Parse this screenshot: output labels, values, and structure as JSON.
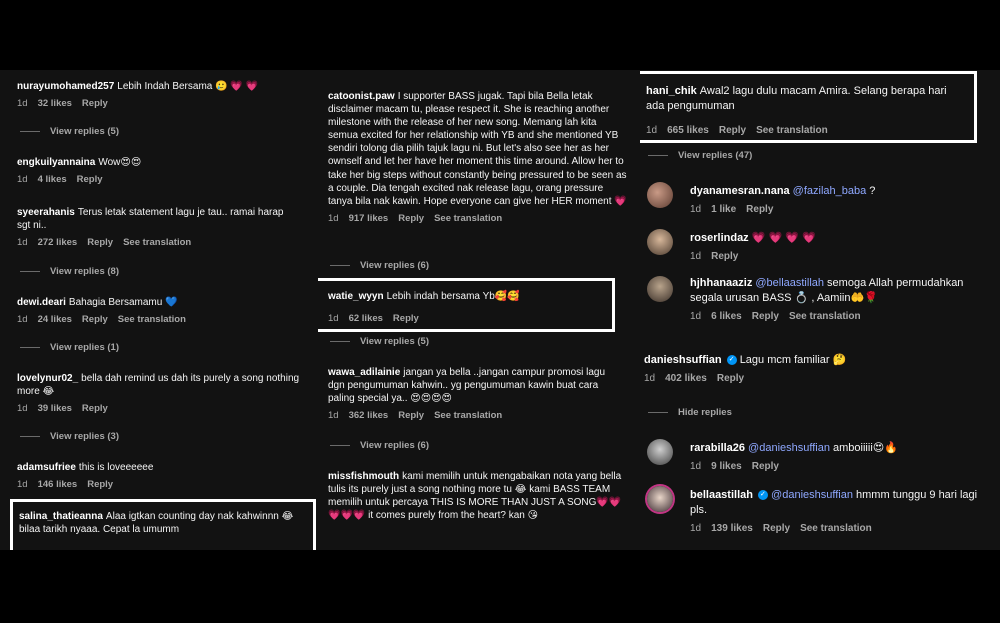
{
  "colors": {
    "background": "#000000",
    "panel": "#121212",
    "meta_text": "#a8a8a8",
    "heart": "#ff3040",
    "mention": "#8fa8ff",
    "highlight_box": "#ffffff"
  },
  "ui": {
    "reply": "Reply",
    "see_translation": "See translation",
    "hide_replies": "Hide replies"
  },
  "col1": {
    "c1": {
      "user": "nurayumohamed257",
      "text": "Lebih Indah Bersama 🥲 💗 💗",
      "time": "1d",
      "likes": "32 likes",
      "view_replies": "View replies (5)"
    },
    "c2": {
      "user": "engkuilyannaina",
      "text": "Wow😍😍",
      "time": "1d",
      "likes": "4 likes"
    },
    "c3": {
      "user": "syeerahanis",
      "text": "Terus letak statement lagu je tau.. ramai harap sgt ni..",
      "time": "1d",
      "likes": "272 likes",
      "view_replies": "View replies (8)"
    },
    "c4": {
      "user": "dewi.deari",
      "text": "Bahagia Bersamamu 💙",
      "time": "1d",
      "likes": "24 likes",
      "view_replies": "View replies (1)"
    },
    "c5": {
      "user": "lovelynur02_",
      "text": "bella dah remind us dah its purely a song nothing more 😂",
      "time": "1d",
      "likes": "39 likes",
      "view_replies": "View replies (3)"
    },
    "c6": {
      "user": "adamsufriee",
      "text": "this is loveeeeee",
      "time": "1d",
      "likes": "146 likes"
    },
    "c7": {
      "user": "salina_thatieanna",
      "text": "Alaa igtkan counting day nak kahwinnn 😂 bilaa tarikh nyaaa. Cepat la umumm"
    }
  },
  "col2": {
    "c1": {
      "user": "catoonist.paw",
      "text": "I supporter BASS jugak. Tapi bila Bella letak disclaimer macam tu, please respect it. She is reaching another milestone with the release of her new song. Memang lah kita semua excited for her relationship with YB and she mentioned YB sendiri tolong dia pilih tajuk lagu ni. But let's also see her as her ownself and let her have her moment this time around. Allow her to take her big steps without constantly being pressured to be seen as a couple. Dia tengah excited nak release lagu, orang pressure tanya bila nak kawin. Hope everyone can give her HER moment 💗",
      "time": "1d",
      "likes": "917 likes",
      "view_replies": "View replies (6)"
    },
    "c2": {
      "user": "watie_wyyn",
      "text": "Lebih indah bersama Yb🥰🥰",
      "time": "1d",
      "likes": "62 likes",
      "view_replies": "View replies (5)"
    },
    "c3": {
      "user": "wawa_adilainie",
      "text": "jangan ya bella ..jangan campur promosi lagu dgn pengumuman kahwin.. yg pengumuman kawin buat cara paling special ya.. 😍😍😍😍",
      "time": "1d",
      "likes": "362 likes",
      "view_replies": "View replies (6)"
    },
    "c4": {
      "user": "missfishmouth",
      "text": "kami memilih untuk mengabaikan nota yang bella tulis its purely just a song nothing more tu 😂 kami BASS TEAM memilih untuk percaya THIS IS MORE THAN JUST A SONG💗💗💗💗💗 it comes purely from the heart? kan 😘"
    }
  },
  "col3": {
    "c1": {
      "user": "hani_chik",
      "text": "Awal2 lagu dulu macam Amira. Selang berapa hari ada pengumuman",
      "time": "1d",
      "likes": "665 likes",
      "view_replies": "View replies (47)"
    },
    "c2": {
      "user": "dyanamesran.nana",
      "mention": "@fazilah_baba",
      "text": " ?",
      "time": "1d",
      "likes": "1 like"
    },
    "c3": {
      "user": "roserlindaz",
      "text": "💗 💗 💗 💗",
      "time": "1d"
    },
    "c4": {
      "user": "hjhhanaaziz",
      "mention": "@bellaastillah",
      "text": " semoga Allah permudahkan segala urusan BASS 💍 , Aamiin🤲🌹",
      "time": "1d",
      "likes": "6 likes"
    },
    "c5": {
      "user": "danieshsuffian",
      "text": "Lagu mcm familiar 🤔",
      "time": "1d",
      "likes": "402 likes"
    },
    "c6": {
      "user": "rarabilla26",
      "mention": "@danieshsuffian",
      "text": " amboiiiii😍🔥",
      "time": "1d",
      "likes": "9 likes"
    },
    "c7": {
      "user": "bellaastillah",
      "mention": "@danieshsuffian",
      "text": " hmmm tunggu 9 hari lagi pls.",
      "time": "1d",
      "likes": "139 likes"
    }
  }
}
